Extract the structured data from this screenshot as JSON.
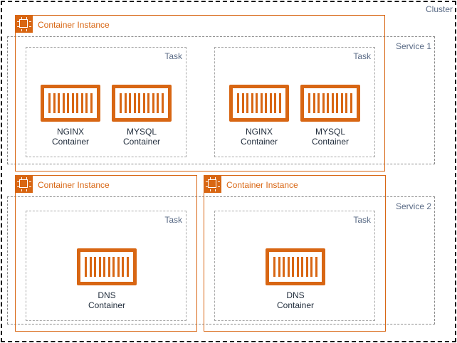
{
  "cluster": {
    "label": "Cluster"
  },
  "services": [
    {
      "label": "Service 1"
    },
    {
      "label": "Service 2"
    }
  ],
  "instances": [
    {
      "label": "Container Instance"
    },
    {
      "label": "Container Instance"
    },
    {
      "label": "Container Instance"
    }
  ],
  "tasks": [
    {
      "label": "Task",
      "containers": [
        {
          "line1": "NGINX",
          "line2": "Container"
        },
        {
          "line1": "MYSQL",
          "line2": "Container"
        }
      ]
    },
    {
      "label": "Task",
      "containers": [
        {
          "line1": "NGINX",
          "line2": "Container"
        },
        {
          "line1": "MYSQL",
          "line2": "Container"
        }
      ]
    },
    {
      "label": "Task",
      "containers": [
        {
          "line1": "DNS",
          "line2": "Container"
        }
      ]
    },
    {
      "label": "Task",
      "containers": [
        {
          "line1": "DNS",
          "line2": "Container"
        }
      ]
    }
  ],
  "colors": {
    "accent": "#d86613",
    "label_blue": "#5a6b86",
    "text": "#232f3e"
  },
  "icons": {
    "instance": "ec2-instance-icon",
    "container": "container-icon"
  }
}
